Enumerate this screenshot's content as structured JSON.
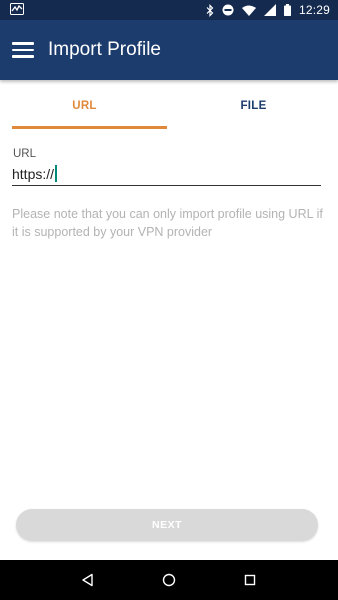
{
  "status_bar": {
    "time": "12:29",
    "icons": [
      "activity-icon",
      "bluetooth-icon",
      "do-not-disturb-icon",
      "wifi-icon",
      "signal-icon",
      "battery-icon"
    ]
  },
  "app_bar": {
    "menu_icon": "menu-icon",
    "title": "Import Profile"
  },
  "tabs": [
    {
      "label": "URL",
      "active": true
    },
    {
      "label": "FILE",
      "active": false
    }
  ],
  "form": {
    "url_label": "URL",
    "url_value": "https://"
  },
  "note": "Please note that you can only import profile using URL if it is supported by your VPN provider",
  "next_button": {
    "label": "NEXT",
    "enabled": false
  },
  "nav_bar": {
    "icons": [
      "back-icon",
      "home-icon",
      "recents-icon"
    ]
  },
  "colors": {
    "status_bar": "#142a4f",
    "app_bar": "#1d3c6e",
    "accent": "#e0893a",
    "disabled_button": "#d9d9d9"
  }
}
